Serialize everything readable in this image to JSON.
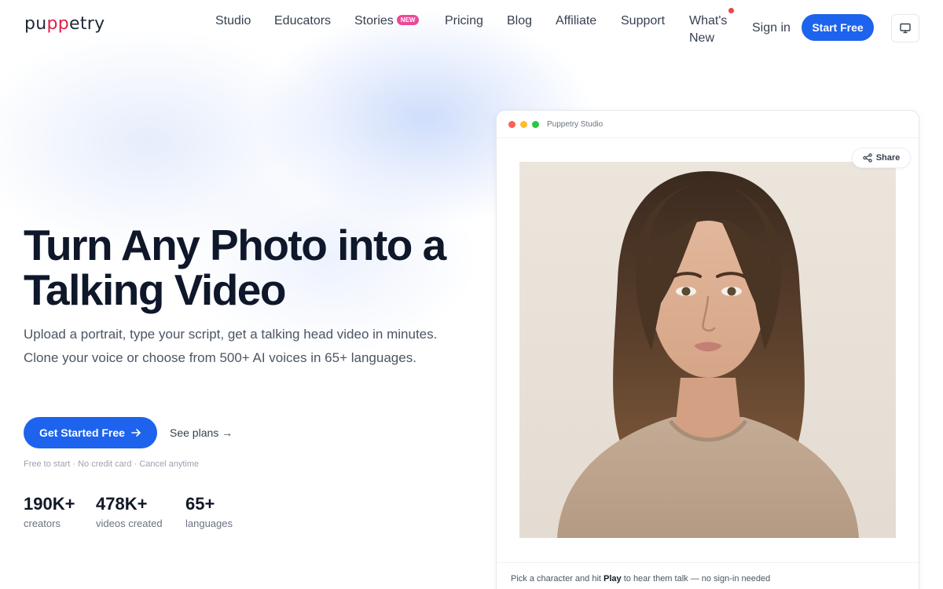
{
  "brand": {
    "logo_pre": "pu",
    "logo_accent": "pp",
    "logo_post": "etry"
  },
  "nav": {
    "studio": "Studio",
    "educators": "Educators",
    "stories": "Stories",
    "stories_badge": "NEW",
    "pricing": "Pricing",
    "blog": "Blog",
    "affiliate": "Affiliate",
    "support": "Support",
    "whats_new": "What's New",
    "sign_in": "Sign in",
    "start_free": "Start Free",
    "theme_icon": "monitor-icon"
  },
  "hero": {
    "title": "Turn Any Photo into a Talking Video",
    "subtitle": "Upload a portrait, type your script, get a talking head video in minutes. Clone your voice or choose from 500+ AI voices in 65+ languages.",
    "cta_primary": "Get Started Free",
    "cta_secondary": "See plans →",
    "fine_print": "Free to start · No credit card · Cancel anytime"
  },
  "stats": [
    {
      "value": "190K+",
      "label": "creators"
    },
    {
      "value": "478K+",
      "label": "videos created"
    },
    {
      "value": "65+",
      "label": "languages"
    }
  ],
  "studio": {
    "window_title": "Puppetry Studio",
    "share_label": "Share",
    "hint_pre": "Pick a character and hit ",
    "hint_bold": "Play",
    "hint_post": " to hear them talk — no sign-in needed"
  },
  "colors": {
    "primary": "#1d63ed",
    "logo_accent": "#e11d48",
    "badge": "#ec4899",
    "dot_red": "#ff5f57",
    "dot_yellow": "#febc2e",
    "dot_green": "#28c840"
  }
}
